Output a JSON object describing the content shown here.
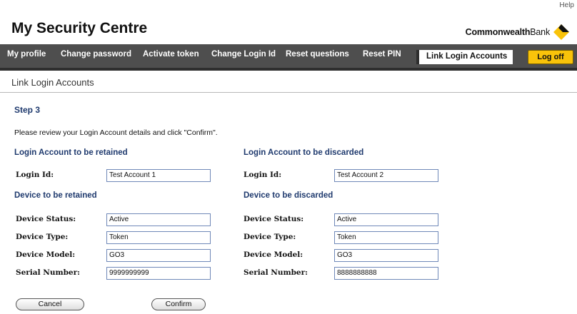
{
  "header": {
    "title": "My Security Centre",
    "help": "Help",
    "brand_bold": "Commonwealth",
    "brand_light": "Bank",
    "brand_color": "#f9c30a"
  },
  "nav": {
    "items": [
      "My profile",
      "Change password",
      "Activate token",
      "Change Login Id",
      "Reset questions",
      "Reset PIN"
    ],
    "active": "Link Login Accounts",
    "logoff": "Log off"
  },
  "page": {
    "heading": "Link Login Accounts",
    "step": "Step 3",
    "instructions": "Please review your Login Account details and click \"Confirm\"."
  },
  "retained": {
    "account_title": "Login Account to be retained",
    "login_id_label": "Login Id:",
    "login_id": "Test Account 1",
    "device_title": "Device to be retained",
    "status_label": "Device Status:",
    "status": "Active",
    "type_label": "Device Type:",
    "type": "Token",
    "model_label": "Device Model:",
    "model": "GO3",
    "serial_label": "Serial Number:",
    "serial": "9999999999"
  },
  "discarded": {
    "account_title": "Login Account to be discarded",
    "login_id_label": "Login Id:",
    "login_id": "Test Account 2",
    "device_title": "Device to be discarded",
    "status_label": "Device Status:",
    "status": "Active",
    "type_label": "Device Type:",
    "type": "Token",
    "model_label": "Device Model:",
    "model": "GO3",
    "serial_label": "Serial Number:",
    "serial": "8888888888"
  },
  "buttons": {
    "cancel": "Cancel",
    "confirm": "Confirm"
  }
}
